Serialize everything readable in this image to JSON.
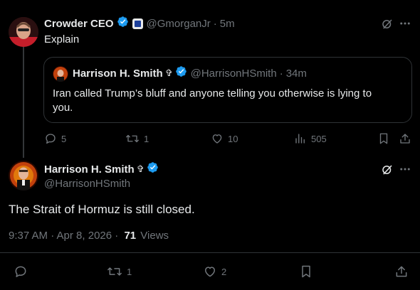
{
  "reply": {
    "author_name": "Crowder CEO",
    "handle": "@GmorganJr",
    "time": "5m",
    "text": "Explain",
    "quote": {
      "author_name": "Harrison H. Smith",
      "cross": "✞",
      "handle": "@HarrisonHSmith",
      "time": "34m",
      "text": "Iran called Trump’s bluff and anyone telling you otherwise is lying to you."
    },
    "actions": {
      "replies": "5",
      "reposts": "1",
      "likes": "10",
      "views": "505"
    }
  },
  "main": {
    "author_name": "Harrison H. Smith",
    "cross": "✞",
    "handle": "@HarrisonHSmith",
    "text": "The Strait of Hormuz is still closed.",
    "timestamp": "9:37 AM · Apr 8, 2026 ·",
    "views_count": "71",
    "views_label": "Views",
    "actions": {
      "reposts": "1",
      "likes": "2"
    }
  },
  "colors": {
    "verified": "#1d9bf0",
    "muted": "#71767b",
    "text": "#e7e9ea",
    "border": "#2f3336"
  }
}
